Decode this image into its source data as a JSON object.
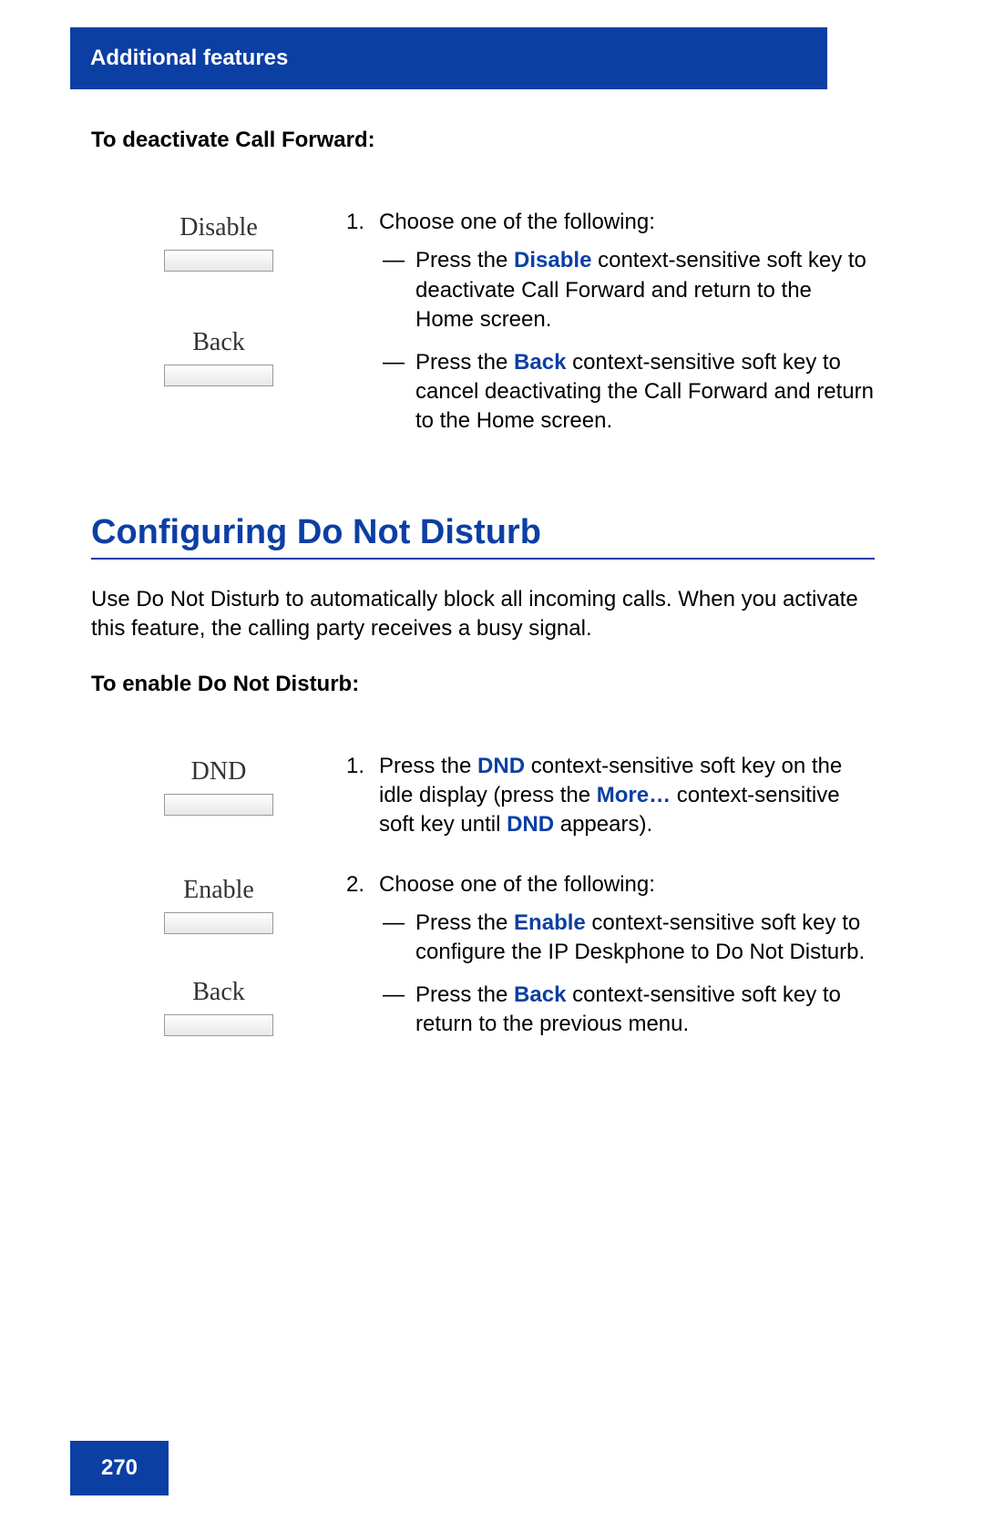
{
  "header": {
    "title": "Additional features"
  },
  "sec1": {
    "subhead": "To deactivate Call Forward:",
    "softkeys": {
      "key1": "Disable",
      "key2": "Back"
    },
    "step": {
      "num": "1.",
      "lead": "Choose one of the following:",
      "dash": "—",
      "item1": {
        "pre": "Press the ",
        "kw": "Disable",
        "post": " context-sensitive soft key to deactivate Call Forward and return to the Home screen."
      },
      "item2": {
        "pre": "Press the ",
        "kw": "Back",
        "post": " context-sensitive soft key to cancel deactivating the Call Forward and return to the Home screen."
      }
    }
  },
  "sec2": {
    "title": "Configuring Do Not Disturb",
    "intro": "Use Do Not Disturb to automatically block all incoming calls. When you activate this feature, the calling party receives a busy signal.",
    "subhead": "To enable Do Not Disturb:",
    "softkeys1": {
      "key1": "DND"
    },
    "step1": {
      "num": "1.",
      "t1": "Press the ",
      "kw1": "DND",
      "t2": " context-sensitive soft key on the idle display (press the ",
      "kw2": "More…",
      "t3": " context-sensitive soft key until ",
      "kw3": "DND",
      "t4": " appears)."
    },
    "softkeys2": {
      "key1": "Enable",
      "key2": "Back"
    },
    "step2": {
      "num": "2.",
      "lead": "Choose one of the following:",
      "dash": "—",
      "item1": {
        "pre": "Press the ",
        "kw": "Enable",
        "post": " context-sensitive soft key to configure the IP Deskphone to Do Not Disturb."
      },
      "item2": {
        "pre": "Press the ",
        "kw": "Back",
        "post": " context-sensitive soft key to return to the previous menu."
      }
    }
  },
  "page_number": "270"
}
